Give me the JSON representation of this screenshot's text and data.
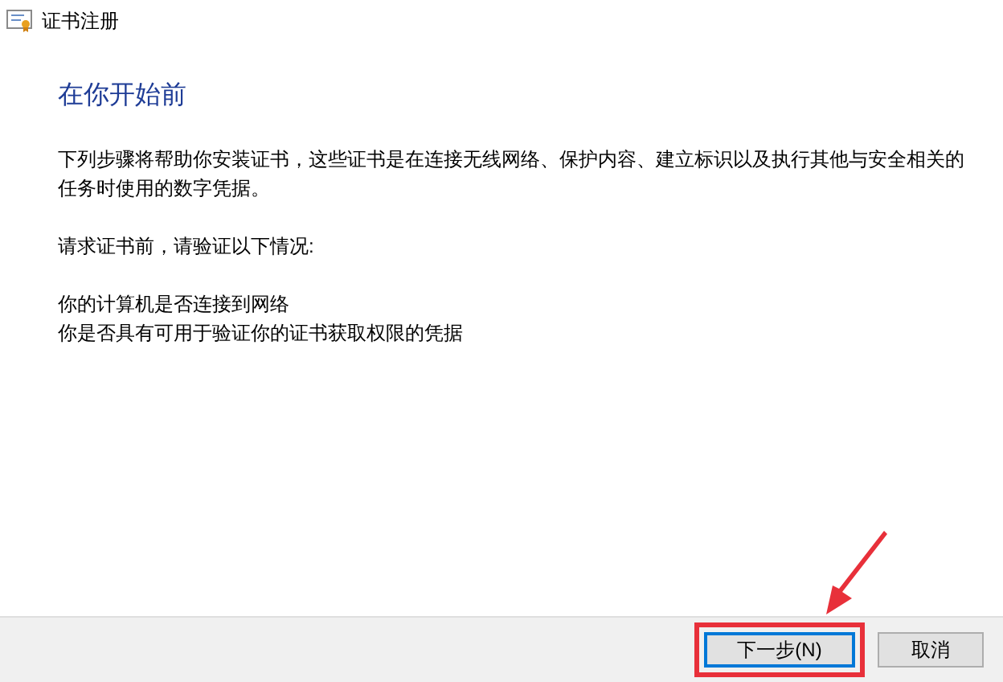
{
  "window": {
    "title": "证书注册"
  },
  "heading": "在你开始前",
  "paragraphs": [
    "下列步骤将帮助你安装证书，这些证书是在连接无线网络、保护内容、建立标识以及执行其他与安全相关的任务时使用的数字凭据。",
    "请求证书前，请验证以下情况:"
  ],
  "checklist": [
    "你的计算机是否连接到网络",
    "你是否具有可用于验证你的证书获取权限的凭据"
  ],
  "buttons": [
    {
      "label": "下一步(N)",
      "default": true,
      "highlighted": true
    },
    {
      "label": "取消",
      "default": false,
      "highlighted": false
    }
  ]
}
